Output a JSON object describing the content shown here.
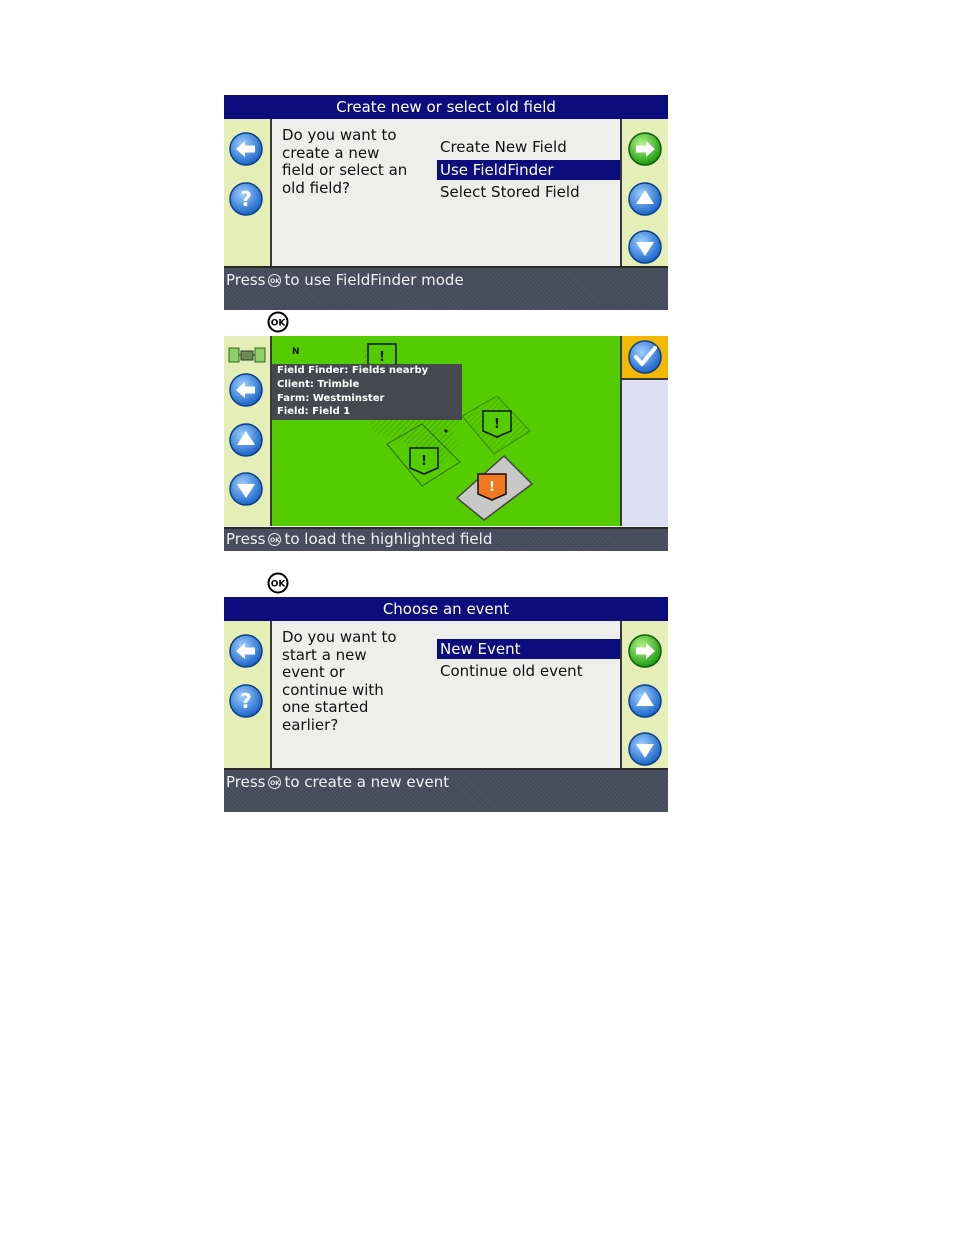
{
  "screen1": {
    "title": "Create new or select old field",
    "question": "Do you want to\ncreate a new\nfield or select an\nold field?",
    "options": [
      "Create New Field",
      "Use FieldFinder",
      "Select Stored Field"
    ],
    "selected_index": 1,
    "status_pre": "Press",
    "status_post": "to use FieldFinder mode"
  },
  "screen2": {
    "north_label": "N",
    "info": {
      "line1": "Field Finder: Fields nearby",
      "line2": "Client: Trimble",
      "line3": "Farm: Westminster",
      "line4": "Field: Field 1"
    },
    "status_pre": "Press",
    "status_post": "to load the highlighted field"
  },
  "screen3": {
    "title": "Choose an event",
    "question": "Do you want to\nstart a new\nevent or\ncontinue with\none started\nearlier?",
    "options": [
      "New Event",
      "Continue old event"
    ],
    "selected_index": 0,
    "status_pre": "Press",
    "status_post": "to create a new event"
  },
  "ok_button_label": "OK",
  "ok_mini_label": "OK",
  "colors": {
    "title_bar": "#0c0c7c",
    "side_panel": "#e4eeb6",
    "map_green": "#55cc00",
    "selected_field": "#f07820",
    "status_bar": "#444b5a"
  }
}
